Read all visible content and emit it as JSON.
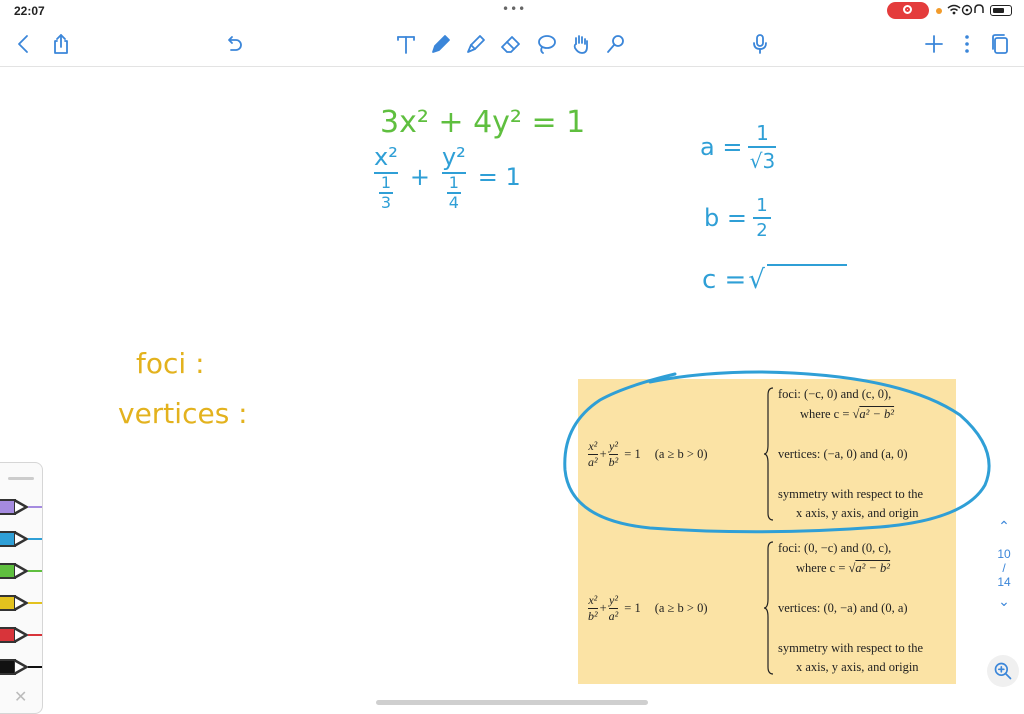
{
  "status": {
    "time": "22:07"
  },
  "pager": {
    "current": "10",
    "sep": "/",
    "total": "14"
  },
  "notes": {
    "eq1": "3x² + 4y² = 1",
    "eq2_num1": "x²",
    "eq2_den1": "1",
    "eq2_den1b": "3",
    "eq2_plus": "+",
    "eq2_num2": "y²",
    "eq2_den2": "1",
    "eq2_den2b": "4",
    "eq2_rhs": "= 1",
    "a_lhs": "a =",
    "a_num": "1",
    "a_den": "√3",
    "b_lhs": "b =",
    "b_num": "1",
    "b_den": "2",
    "c_lhs": "c =",
    "c_sqrt": "√",
    "foci": "foci :",
    "vertices": "vertices :"
  },
  "table": {
    "rows": [
      {
        "eq_left_num": "x²",
        "eq_left_den": "a²",
        "eq_plus": "+",
        "eq_right_num": "y²",
        "eq_right_den": "b²",
        "eq_rhs": "= 1",
        "cond": "(a ≥ b > 0)",
        "foci": "foci: (−c, 0) and (c, 0),",
        "where": "where c = √",
        "where_rad": "a² − b²",
        "vertices": "vertices: (−a, 0) and (a, 0)",
        "sym1": "symmetry with respect to the",
        "sym2": "x axis, y axis, and origin"
      },
      {
        "eq_left_num": "x²",
        "eq_left_den": "b²",
        "eq_plus": "+",
        "eq_right_num": "y²",
        "eq_right_den": "a²",
        "eq_rhs": "= 1",
        "cond": "(a ≥ b > 0)",
        "foci": "foci: (0, −c) and (0, c),",
        "where": "where c = √",
        "where_rad": "a² − b²",
        "vertices": "vertices: (0, −a) and (0, a)",
        "sym1": "symmetry with respect to the",
        "sym2": "x axis, y axis, and origin"
      }
    ]
  },
  "colors": {
    "accent": "#3b86d9",
    "ink_green": "#5fbf3f",
    "ink_blue": "#2f9fd6",
    "ink_yellow": "#e3b21e",
    "highlight": "#fbe3a5",
    "rec": "#e43c3c"
  },
  "pens": [
    {
      "name": "purple-pen",
      "color": "#a58be0"
    },
    {
      "name": "blue-pen",
      "color": "#2f9fd6"
    },
    {
      "name": "green-pen",
      "color": "#5fbf3f"
    },
    {
      "name": "yellow-pen",
      "color": "#e3c21e"
    },
    {
      "name": "red-pen",
      "color": "#d8343a"
    },
    {
      "name": "black-pen",
      "color": "#111111"
    }
  ]
}
